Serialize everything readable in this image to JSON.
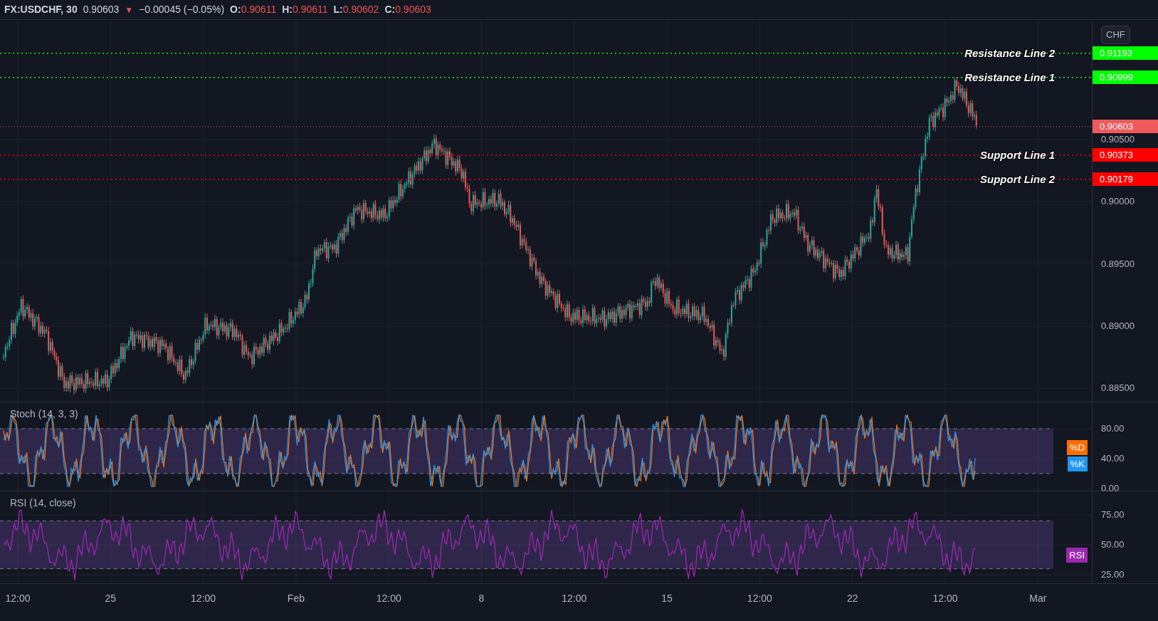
{
  "header": {
    "symbol": "FX:USDCHF, 30",
    "price": "0.90603",
    "change_icon": "▼",
    "change": "−0.00045 (−0.05%)",
    "ohlc": [
      {
        "label": "O:",
        "value": "0.90611"
      },
      {
        "label": "H:",
        "value": "0.90611"
      },
      {
        "label": "L:",
        "value": "0.90602"
      },
      {
        "label": "C:",
        "value": "0.90603"
      }
    ]
  },
  "price_pane": {
    "currency": "CHF",
    "ticks": [
      "0.90500",
      "0.90000",
      "0.89500",
      "0.89000",
      "0.88500"
    ],
    "lines": [
      {
        "label": "Resistance Line 2",
        "value": "0.91193",
        "color": "#00ff00"
      },
      {
        "label": "Resistance Line 1",
        "value": "0.90999",
        "color": "#00ff00"
      },
      {
        "label": "Support Line 1",
        "value": "0.90373",
        "color": "#ff0000"
      },
      {
        "label": "Support Line 2",
        "value": "0.90179",
        "color": "#ff0000"
      }
    ],
    "last_price": "0.90603"
  },
  "stoch": {
    "title": "Stoch (14, 3, 3)",
    "ticks": [
      "80.00",
      "40.00",
      "0.00"
    ],
    "legend": [
      {
        "label": "%D",
        "color": "#ff6d00"
      },
      {
        "label": "%K",
        "color": "#2196f3"
      }
    ]
  },
  "rsi": {
    "title": "RSI (14, close)",
    "ticks": [
      "75.00",
      "50.00",
      "25.00"
    ],
    "legend": [
      {
        "label": "RSI",
        "color": "#9c27b0"
      }
    ]
  },
  "time_axis": [
    "12:00",
    "25",
    "12:00",
    "Feb",
    "12:00",
    "8",
    "12:00",
    "15",
    "12:00",
    "22",
    "12:00",
    "Mar"
  ]
}
